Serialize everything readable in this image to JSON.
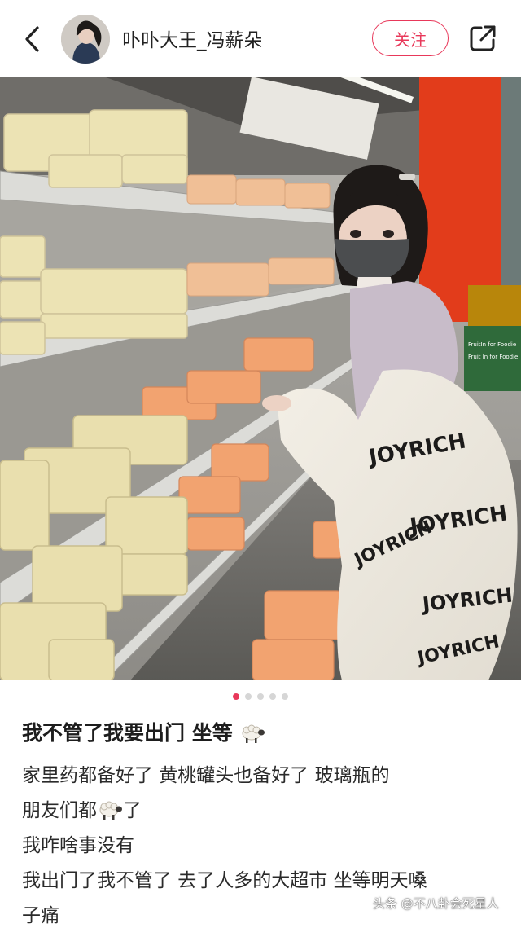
{
  "header": {
    "username": "卟卟大王_冯薪朵",
    "follow_label": "关注"
  },
  "carousel": {
    "current_index": 1,
    "total": 5
  },
  "photo_text": {
    "shelf_sign_1": "FruitIn for Foodie",
    "shelf_sign_2": "Fruit In for Foodie",
    "jacket_print": "JOYRICH"
  },
  "post": {
    "title": "我不管了我要出门 坐等",
    "body_line_1": "家里药都备好了 黄桃罐头也备好了 玻璃瓶的",
    "body_line_2": "朋友们都",
    "body_line_2_suffix": "了",
    "body_line_3": "我咋啥事没有",
    "body_line_4": "我出门了我不管了 去了人多的大超市 坐等明天嗓",
    "body_line_5": "子痛"
  },
  "icons": {
    "back": "back-arrow-icon",
    "share": "share-icon",
    "emoji": "sheep-emoji-icon"
  },
  "colors": {
    "accent": "#e8385a",
    "store_red": "#e23c1b"
  },
  "watermark": "头条 @不八卦会死星人"
}
